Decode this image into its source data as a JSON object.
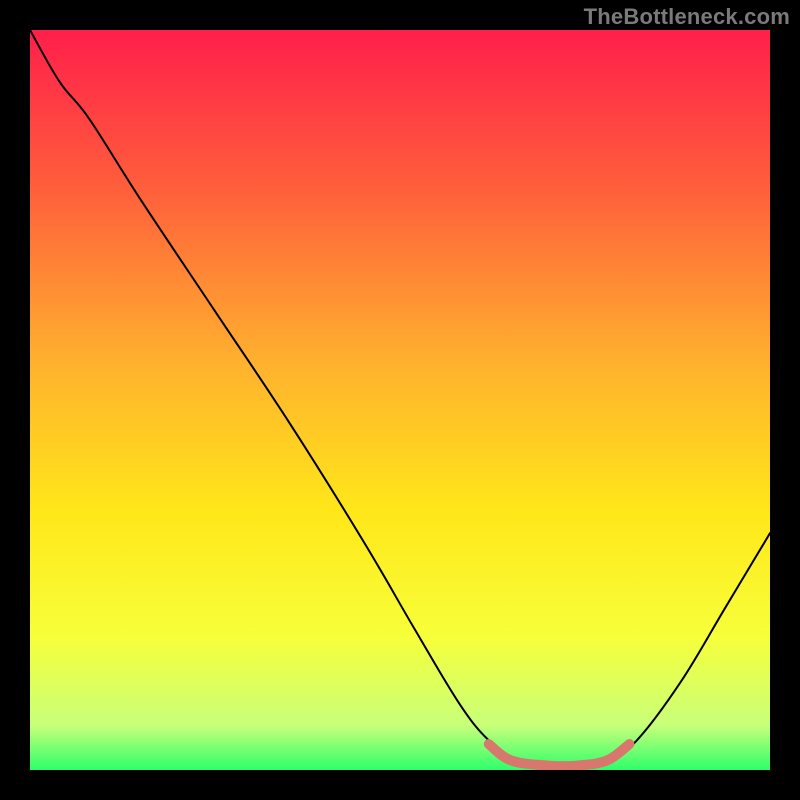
{
  "watermark": "TheBottleneck.com",
  "chart_data": {
    "type": "line",
    "title": "",
    "xlabel": "",
    "ylabel": "",
    "xlim": [
      0,
      100
    ],
    "ylim": [
      0,
      100
    ],
    "gradient_stops": [
      {
        "offset": 0,
        "color": "#ff1f4b"
      },
      {
        "offset": 20,
        "color": "#ff5a3c"
      },
      {
        "offset": 45,
        "color": "#ffb12e"
      },
      {
        "offset": 65,
        "color": "#ffe719"
      },
      {
        "offset": 82,
        "color": "#f7ff3a"
      },
      {
        "offset": 94,
        "color": "#c8ff7a"
      },
      {
        "offset": 100,
        "color": "#2eff6b"
      }
    ],
    "series": [
      {
        "name": "curve",
        "color": "#000000",
        "width": 2,
        "points": [
          {
            "x": 0,
            "y": 100
          },
          {
            "x": 4,
            "y": 93
          },
          {
            "x": 8,
            "y": 88
          },
          {
            "x": 15,
            "y": 77
          },
          {
            "x": 25,
            "y": 62
          },
          {
            "x": 35,
            "y": 47
          },
          {
            "x": 45,
            "y": 31
          },
          {
            "x": 52,
            "y": 19
          },
          {
            "x": 58,
            "y": 9
          },
          {
            "x": 62,
            "y": 4
          },
          {
            "x": 66,
            "y": 1.2
          },
          {
            "x": 70,
            "y": 0.5
          },
          {
            "x": 74,
            "y": 0.5
          },
          {
            "x": 78,
            "y": 1.2
          },
          {
            "x": 82,
            "y": 4
          },
          {
            "x": 88,
            "y": 12
          },
          {
            "x": 94,
            "y": 22
          },
          {
            "x": 100,
            "y": 32
          }
        ]
      },
      {
        "name": "highlight",
        "color": "#d8776e",
        "width": 10,
        "points": [
          {
            "x": 62,
            "y": 3.5
          },
          {
            "x": 65,
            "y": 1.3
          },
          {
            "x": 70,
            "y": 0.6
          },
          {
            "x": 74,
            "y": 0.6
          },
          {
            "x": 78,
            "y": 1.3
          },
          {
            "x": 81,
            "y": 3.5
          }
        ]
      }
    ]
  }
}
